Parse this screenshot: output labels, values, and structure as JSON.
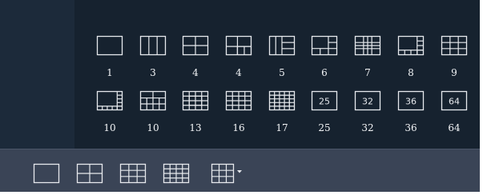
{
  "layout_picker": {
    "row1": [
      {
        "label": "1",
        "icon": "layout-1-icon"
      },
      {
        "label": "3",
        "icon": "layout-3-icon"
      },
      {
        "label": "4",
        "icon": "layout-4-icon"
      },
      {
        "label": "4",
        "icon": "layout-4-alt-icon"
      },
      {
        "label": "5",
        "icon": "layout-5-icon"
      },
      {
        "label": "6",
        "icon": "layout-6-icon"
      },
      {
        "label": "7",
        "icon": "layout-7-icon"
      },
      {
        "label": "8",
        "icon": "layout-8-icon"
      },
      {
        "label": "9",
        "icon": "layout-9-icon"
      }
    ],
    "row2": [
      {
        "label": "10",
        "icon": "layout-10-icon"
      },
      {
        "label": "10",
        "icon": "layout-10-alt-icon"
      },
      {
        "label": "13",
        "icon": "layout-13-icon"
      },
      {
        "label": "16",
        "icon": "layout-16-icon"
      },
      {
        "label": "17",
        "icon": "layout-17-icon"
      },
      {
        "label": "25",
        "icon": "layout-25-icon",
        "inner": "25"
      },
      {
        "label": "32",
        "icon": "layout-32-icon",
        "inner": "32"
      },
      {
        "label": "36",
        "icon": "layout-36-icon",
        "inner": "36"
      },
      {
        "label": "64",
        "icon": "layout-64-icon",
        "inner": "64"
      }
    ]
  },
  "toolbar": {
    "buttons": [
      {
        "icon": "layout-1-icon"
      },
      {
        "icon": "layout-4-icon"
      },
      {
        "icon": "layout-9-icon"
      },
      {
        "icon": "layout-16-icon"
      },
      {
        "icon": "layout-more-dropdown-icon"
      }
    ]
  },
  "colors": {
    "popup_bg": "#16222f",
    "popup_left": "#1c2a3a",
    "toolbar_bg": "#3a4456",
    "icon_stroke": "#e6e9ed",
    "label_text": "#f2f4f6"
  }
}
